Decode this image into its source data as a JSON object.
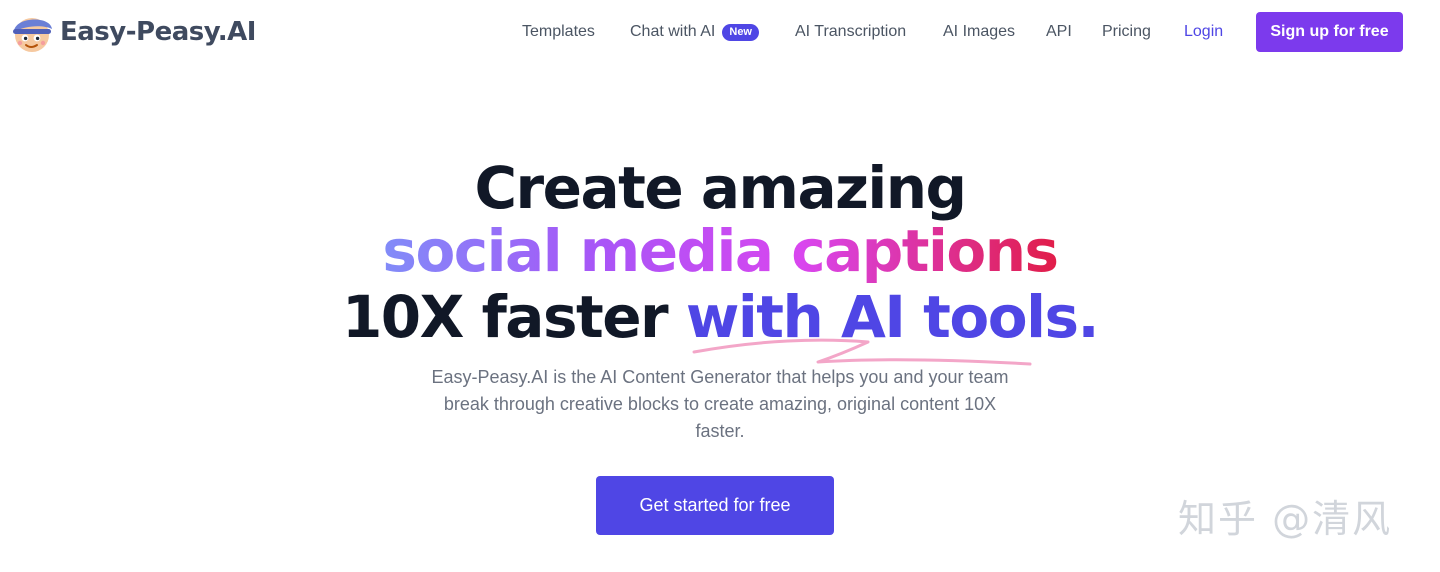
{
  "brand": {
    "logo_text": "Easy-Peasy.AI",
    "logo_icon": "mascot-logo-icon"
  },
  "nav": {
    "templates": "Templates",
    "chat": "Chat with AI",
    "chat_badge": "New",
    "transcription": "AI Transcription",
    "images": "AI Images",
    "api": "API",
    "pricing": "Pricing",
    "login": "Login",
    "signup": "Sign up for free"
  },
  "hero": {
    "line1": "Create amazing",
    "line2": "social media captions",
    "line3_plain": "10X faster ",
    "line3_accent": "with AI",
    "line3_tail": " tools.",
    "subtitle": "Easy-Peasy.AI is the AI Content Generator that helps you and your team break through creative blocks to create amazing, original content 10X faster.",
    "cta": "Get started for free"
  },
  "watermark": "知乎 @清风",
  "colors": {
    "primary": "#4f46e5",
    "signup": "#7c3aed",
    "gradient": [
      "#818cf8",
      "#a855f7",
      "#d946ef",
      "#e11d48"
    ],
    "scribble": "#f3a6c8",
    "text_dark": "#111827",
    "text_muted": "#6b7280"
  }
}
